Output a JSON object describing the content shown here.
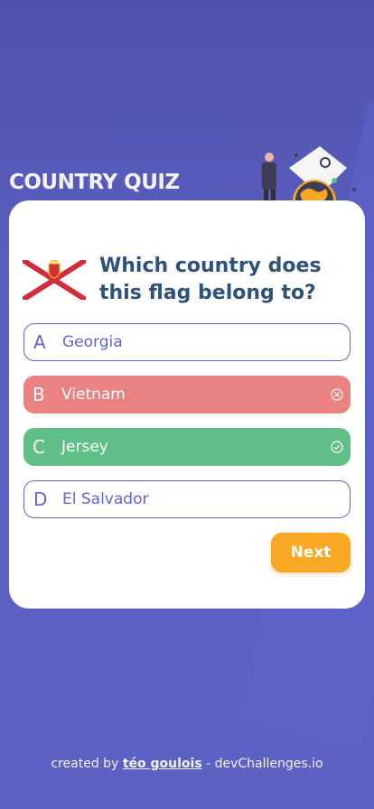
{
  "app": {
    "title": "COUNTRY QUIZ"
  },
  "question": {
    "text": "Which country does this flag belong to?"
  },
  "options": [
    {
      "letter": "A",
      "label": "Georgia",
      "state": "neutral"
    },
    {
      "letter": "B",
      "label": "Vietnam",
      "state": "wrong",
      "icon": "x-circle-icon"
    },
    {
      "letter": "C",
      "label": "Jersey",
      "state": "correct",
      "icon": "check-circle-icon"
    },
    {
      "letter": "D",
      "label": "El Salvador",
      "state": "neutral"
    }
  ],
  "next_label": "Next",
  "footer": {
    "prefix": "created by",
    "author": "téo goulois",
    "suffix": "- devChallenges.io"
  },
  "colors": {
    "accent": "#6066d0",
    "wrong": "#ea8282",
    "correct": "#60bf88",
    "next": "#f9a826",
    "question": "#2f527b"
  }
}
